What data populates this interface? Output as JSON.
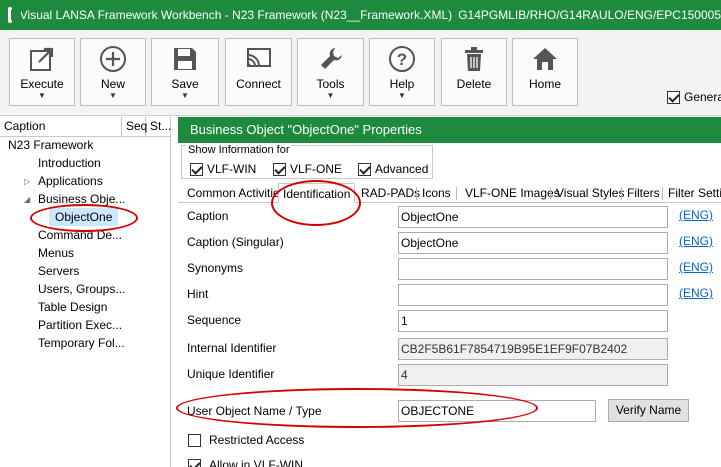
{
  "window": {
    "title": "Visual LANSA Framework Workbench - N23 Framework (N23__Framework.XML)",
    "title_path": "G14PGMLIB/RHO/G14RAULO/ENG/EPC150005"
  },
  "toolbar": {
    "execute": "Execute",
    "new": "New",
    "save": "Save",
    "connect": "Connect",
    "tools": "Tools",
    "help": "Help",
    "delete": "Delete",
    "home": "Home",
    "general": "Genera"
  },
  "tree": {
    "columns": [
      "Caption",
      "Seq",
      "St..."
    ],
    "items": [
      "N23 Framework",
      "Introduction",
      "Applications",
      "Business Obje...",
      "ObjectOne",
      "Command De...",
      "Menus",
      "Servers",
      "Users, Groups...",
      "Table Design",
      "Partition Exec...",
      "Temporary Fol..."
    ]
  },
  "properties": {
    "header": "Business Object \"ObjectOne\" Properties",
    "show_info_title": "Show Information for",
    "show_options": [
      "VLF-WIN",
      "VLF-ONE",
      "Advanced"
    ],
    "tabs": [
      "Common Activities",
      "Identification",
      "RAD-PADs",
      "Icons",
      "VLF-ONE Images",
      "Visual Styles",
      "Filters",
      "Filter Settir"
    ],
    "fields": {
      "caption_label": "Caption",
      "caption_value": "ObjectOne",
      "caption_singular_label": "Caption (Singular)",
      "caption_singular_value": "ObjectOne",
      "synonyms_label": "Synonyms",
      "synonyms_value": "",
      "hint_label": "Hint",
      "hint_value": "",
      "sequence_label": "Sequence",
      "sequence_value": "1",
      "internal_id_label": "Internal Identifier",
      "internal_id_value": "CB2F5B61F7854719B95E1EF9F07B2402",
      "unique_id_label": "Unique Identifier",
      "unique_id_value": "4",
      "user_object_label": "User Object Name / Type",
      "user_object_value": "OBJECTONE"
    },
    "eng_link": "(ENG)",
    "verify_button": "Verify Name",
    "restricted_access": "Restricted Access",
    "allow_vlf_win": "Allow in VLF-WIN"
  },
  "colors": {
    "titlebar": "#1e8a3e",
    "annotation": "#d40000"
  }
}
